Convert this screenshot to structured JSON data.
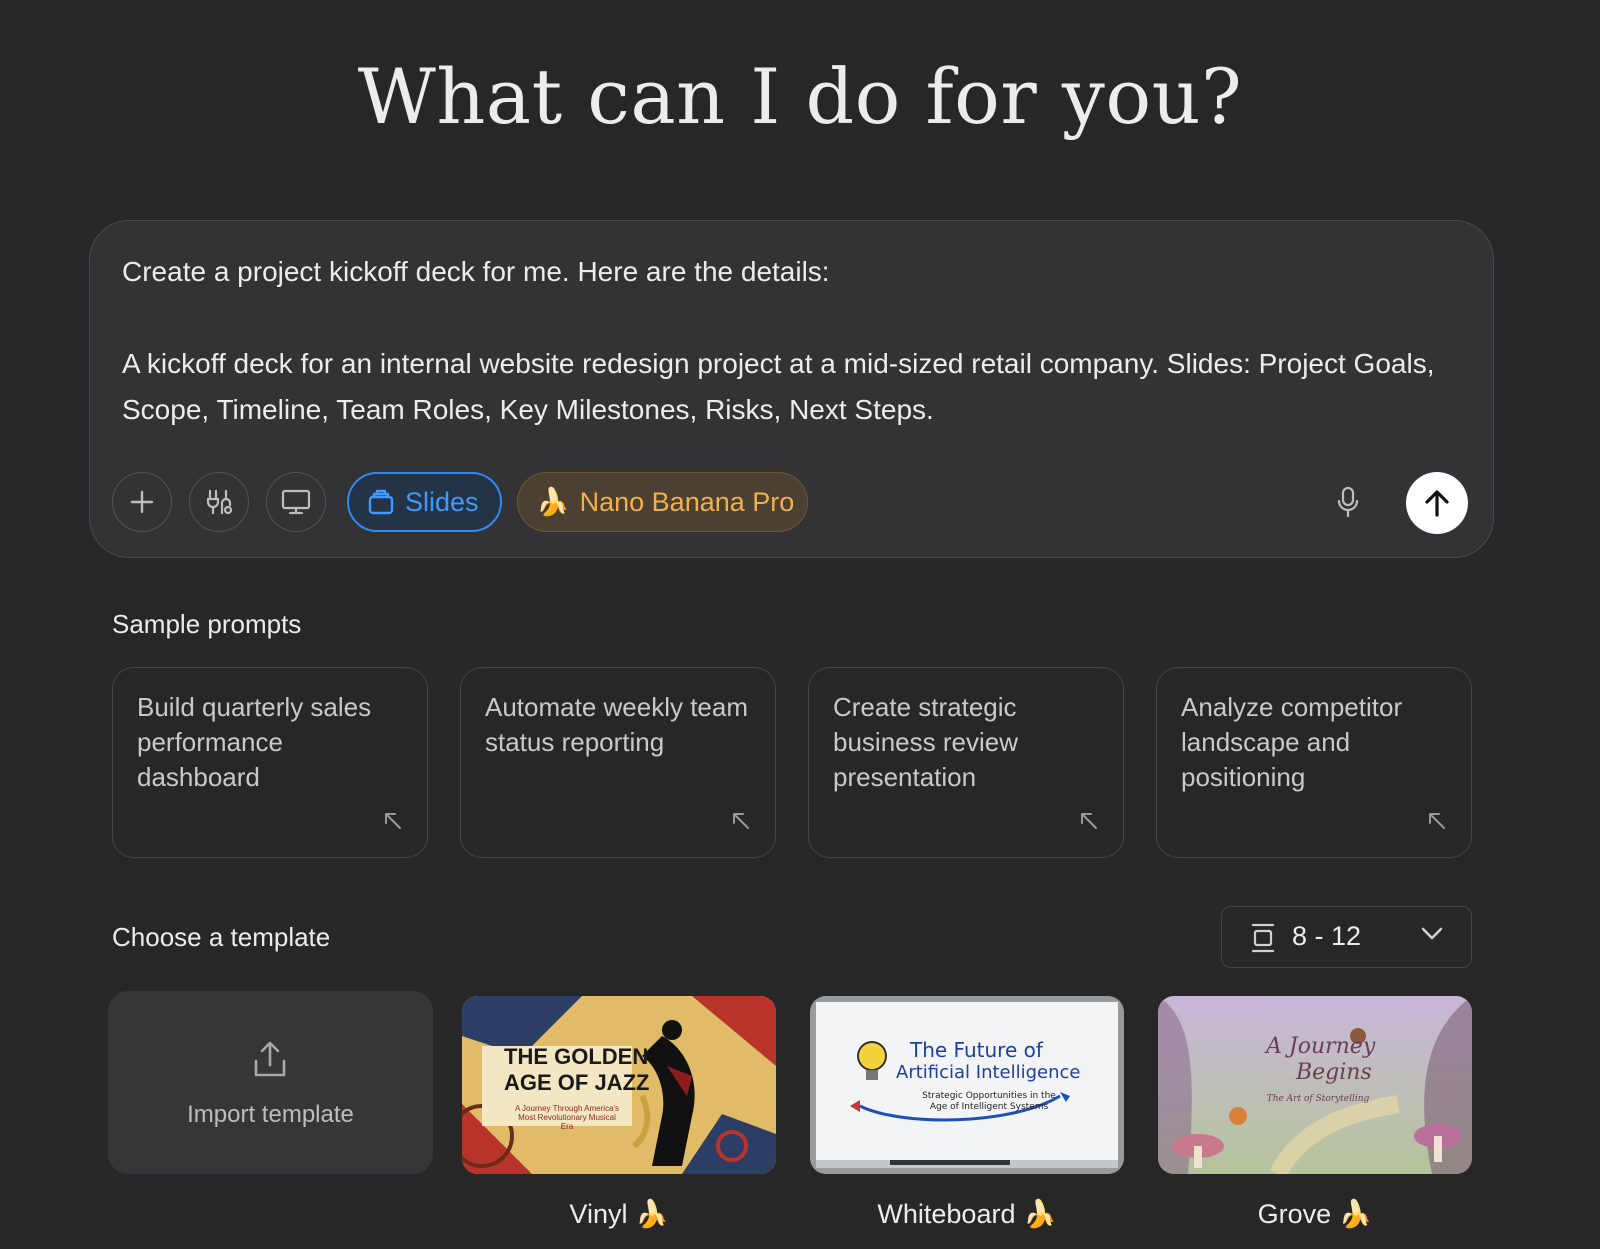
{
  "headline": "What can I do for you?",
  "composer": {
    "text": "Create a project kickoff deck for me. Here are the details:\n\nA kickoff deck for an internal website redesign project at a mid-sized retail company. Slides: Project Goals, Scope, Timeline, Team Roles, Key Milestones, Risks, Next Steps.",
    "mode_label": "Slides",
    "model_label": "Nano Banana Pro",
    "model_emoji": "🍌"
  },
  "sample_prompts": {
    "title": "Sample prompts",
    "items": [
      {
        "text": "Build quarterly sales performance dashboard"
      },
      {
        "text": "Automate weekly team status reporting"
      },
      {
        "text": "Create strategic business review presentation"
      },
      {
        "text": "Analyze competitor landscape and positioning"
      }
    ]
  },
  "templates": {
    "title": "Choose a template",
    "slide_count": "8 - 12",
    "import_label": "Import template",
    "items": [
      {
        "name": "Vinyl 🍌",
        "thumb_title_1": "THE GOLDEN",
        "thumb_title_2": "AGE OF JAZZ",
        "thumb_subtitle": "A Journey Through America's Most Revolutionary Musical Era"
      },
      {
        "name": "Whiteboard 🍌",
        "thumb_title_1": "The Future of",
        "thumb_title_2": "Artificial Intelligence",
        "thumb_subtitle": "Strategic Opportunities in the Age of Intelligent Systems"
      },
      {
        "name": "Grove 🍌",
        "thumb_title_1": "A Journey",
        "thumb_title_2": "Begins",
        "thumb_subtitle": "The Art of Storytelling"
      }
    ]
  }
}
